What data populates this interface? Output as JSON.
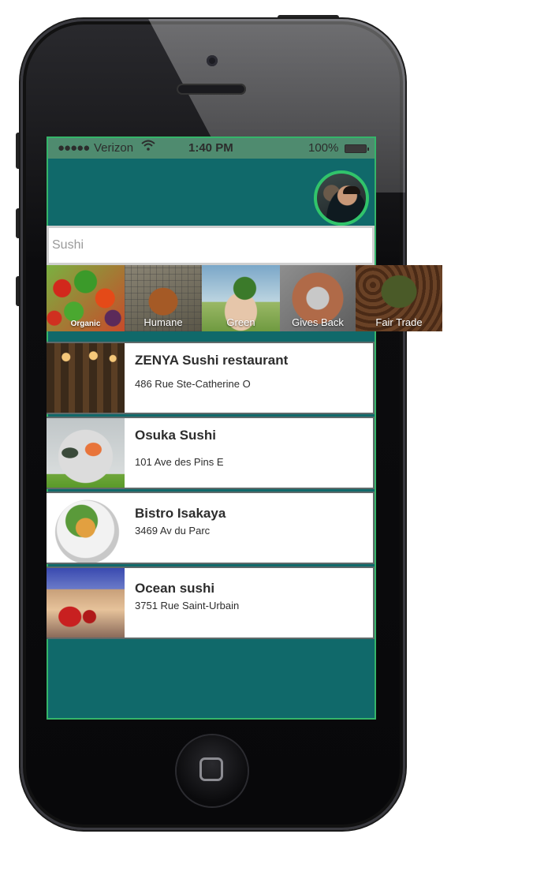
{
  "status_bar": {
    "signal": "●●●●●",
    "carrier": "Verizon",
    "wifi_icon": "wifi-icon",
    "time": "1:40 PM",
    "battery": "100%"
  },
  "search": {
    "value": "Sushi"
  },
  "categories": [
    {
      "label": "Organic"
    },
    {
      "label": "Humane"
    },
    {
      "label": "Green"
    },
    {
      "label": "Gives Back"
    },
    {
      "label": "Fair Trade"
    }
  ],
  "restaurants": [
    {
      "name": "ZENYA Sushi restaurant",
      "address": "486 Rue Ste-Catherine O"
    },
    {
      "name": "Osuka Sushi",
      "address": "101 Ave des Pins E"
    },
    {
      "name": "Bistro Isakaya",
      "address": "3469 Av du Parc"
    },
    {
      "name": "Ocean sushi",
      "address": "3751 Rue Saint-Urbain"
    }
  ],
  "colors": {
    "app_background": "#10696a",
    "accent_border": "#35b56a",
    "avatar_ring": "#31c46b",
    "status_bar": "#4f8b6f"
  }
}
